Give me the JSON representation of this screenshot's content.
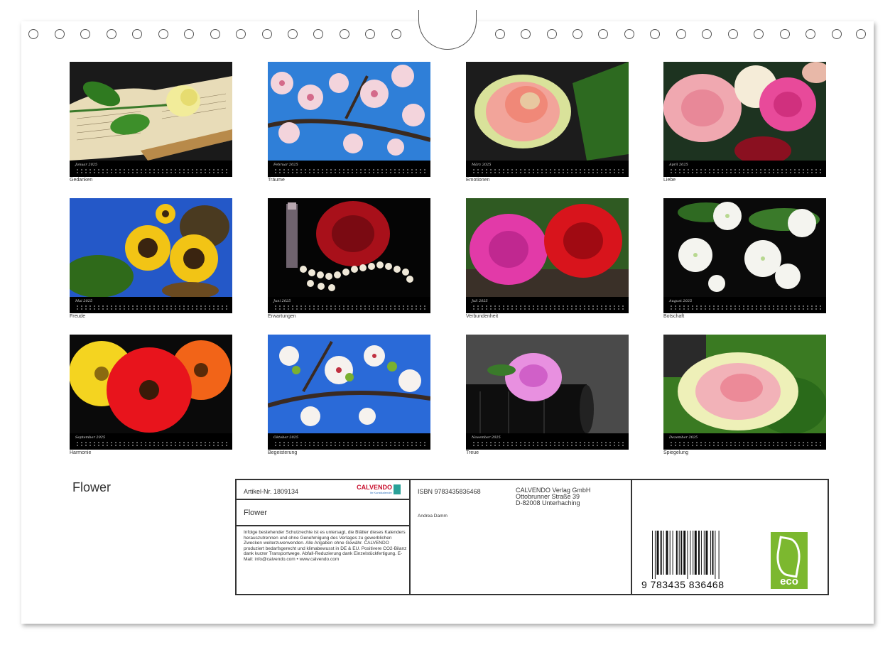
{
  "months": [
    {
      "label": "Januar 2025",
      "caption": "Gedanken"
    },
    {
      "label": "Februar 2025",
      "caption": "Träume"
    },
    {
      "label": "März 2025",
      "caption": "Emotionen"
    },
    {
      "label": "April 2025",
      "caption": "Liebe"
    },
    {
      "label": "Mai 2025",
      "caption": "Freude"
    },
    {
      "label": "Juni 2025",
      "caption": "Erwartungen"
    },
    {
      "label": "Juli 2025",
      "caption": "Verbundenheit"
    },
    {
      "label": "August 2025",
      "caption": "Botschaft"
    },
    {
      "label": "September 2025",
      "caption": "Harmonie"
    },
    {
      "label": "Oktober 2025",
      "caption": "Begeisterung"
    },
    {
      "label": "November 2025",
      "caption": "Treue"
    },
    {
      "label": "Dezember 2025",
      "caption": "Spiegelung"
    }
  ],
  "title": "Flower",
  "info": {
    "article": "Artikel-Nr. 1809134",
    "logo": "CALVENDO",
    "logo_sub": "Ihr Kunstkalender",
    "product_title": "Flower",
    "legal": "Infolge bestehender Schutzrechte ist es untersagt, die Blätter dieses Kalenders herauszutrennen und ohne Genehmigung des Verlages zu gewerblichen Zwecken weiterzuverwenden. Alle Angaben ohne Gewähr. CALVENDO produziert bedarfsgerecht und klimabewusst in DE & EU. Positivere CO2-Bilanz dank kurzer Transportwege. Abfall-Reduzierung dank Einzelstückfertigung. E-Mail: info@calvendo.com • www.calvendo.com",
    "isbn": "ISBN 9783435836468",
    "publisher_name": "CALVENDO Verlag GmbH",
    "publisher_street": "Ottobrunner Straße 39",
    "publisher_city": "D-82008 Unterhaching",
    "author": "Andrea Damm",
    "barcode_number": "9 783435 836468",
    "eco_label": "eco"
  }
}
